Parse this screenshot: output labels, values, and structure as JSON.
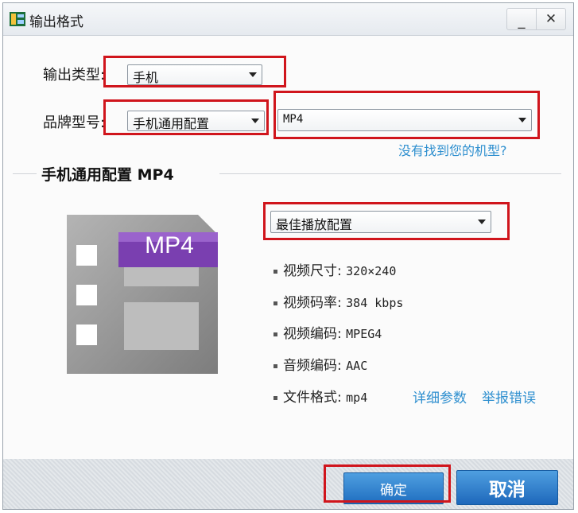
{
  "window": {
    "title": "输出格式",
    "minimize_glyph": "_",
    "close_glyph": "✕"
  },
  "form": {
    "output_type_label": "输出类型:",
    "output_type_value": "手机",
    "brand_model_label": "品牌型号:",
    "brand_value": "手机通用配置",
    "format_value": "MP4",
    "not_found_link": "没有找到您的机型?"
  },
  "preset": {
    "title": "手机通用配置 MP4",
    "quality_value": "最佳播放配置",
    "badge": "MP4",
    "info": [
      {
        "label": "视频尺寸:",
        "value": "320×240"
      },
      {
        "label": "视频码率:",
        "value": "384 kbps"
      },
      {
        "label": "视频编码:",
        "value": "MPEG4"
      },
      {
        "label": "音频编码:",
        "value": "AAC"
      },
      {
        "label": "文件格式:",
        "value": "mp4"
      }
    ],
    "details_link": "详细参数",
    "report_link": "举报错误"
  },
  "footer": {
    "ok_label": "确定",
    "cancel_label": "取消"
  },
  "colors": {
    "highlight": "#d0151c",
    "link": "#2e8fcf",
    "button": "#2a7fd0",
    "badge": "#7a3fb0"
  }
}
